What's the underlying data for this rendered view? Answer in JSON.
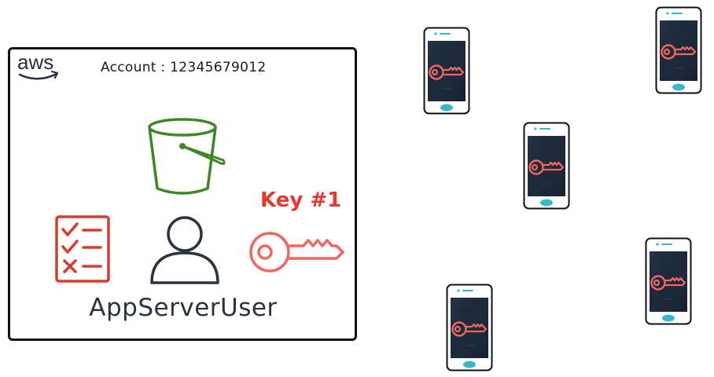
{
  "account": {
    "label": "Account : 12345679012",
    "logo_text": "aws"
  },
  "user": {
    "name": "AppServerUser"
  },
  "key": {
    "label": "Key #1",
    "color": "#e8382c",
    "icon_color": "#f1665f"
  },
  "icons": {
    "bucket": "s3-bucket-icon",
    "checklist": "policy-checklist-icon",
    "user": "user-icon",
    "key": "key-icon",
    "phone": "mobile-phone-icon"
  },
  "colors": {
    "bucket": "#3f8624",
    "checklist": "#d63b2f",
    "user": "#2b3240",
    "phone_screen": "#1d2a3a",
    "phone_button": "#38b7c9"
  },
  "devices": [
    {
      "id": "phone-1"
    },
    {
      "id": "phone-2"
    },
    {
      "id": "phone-3"
    },
    {
      "id": "phone-4"
    },
    {
      "id": "phone-5"
    }
  ]
}
